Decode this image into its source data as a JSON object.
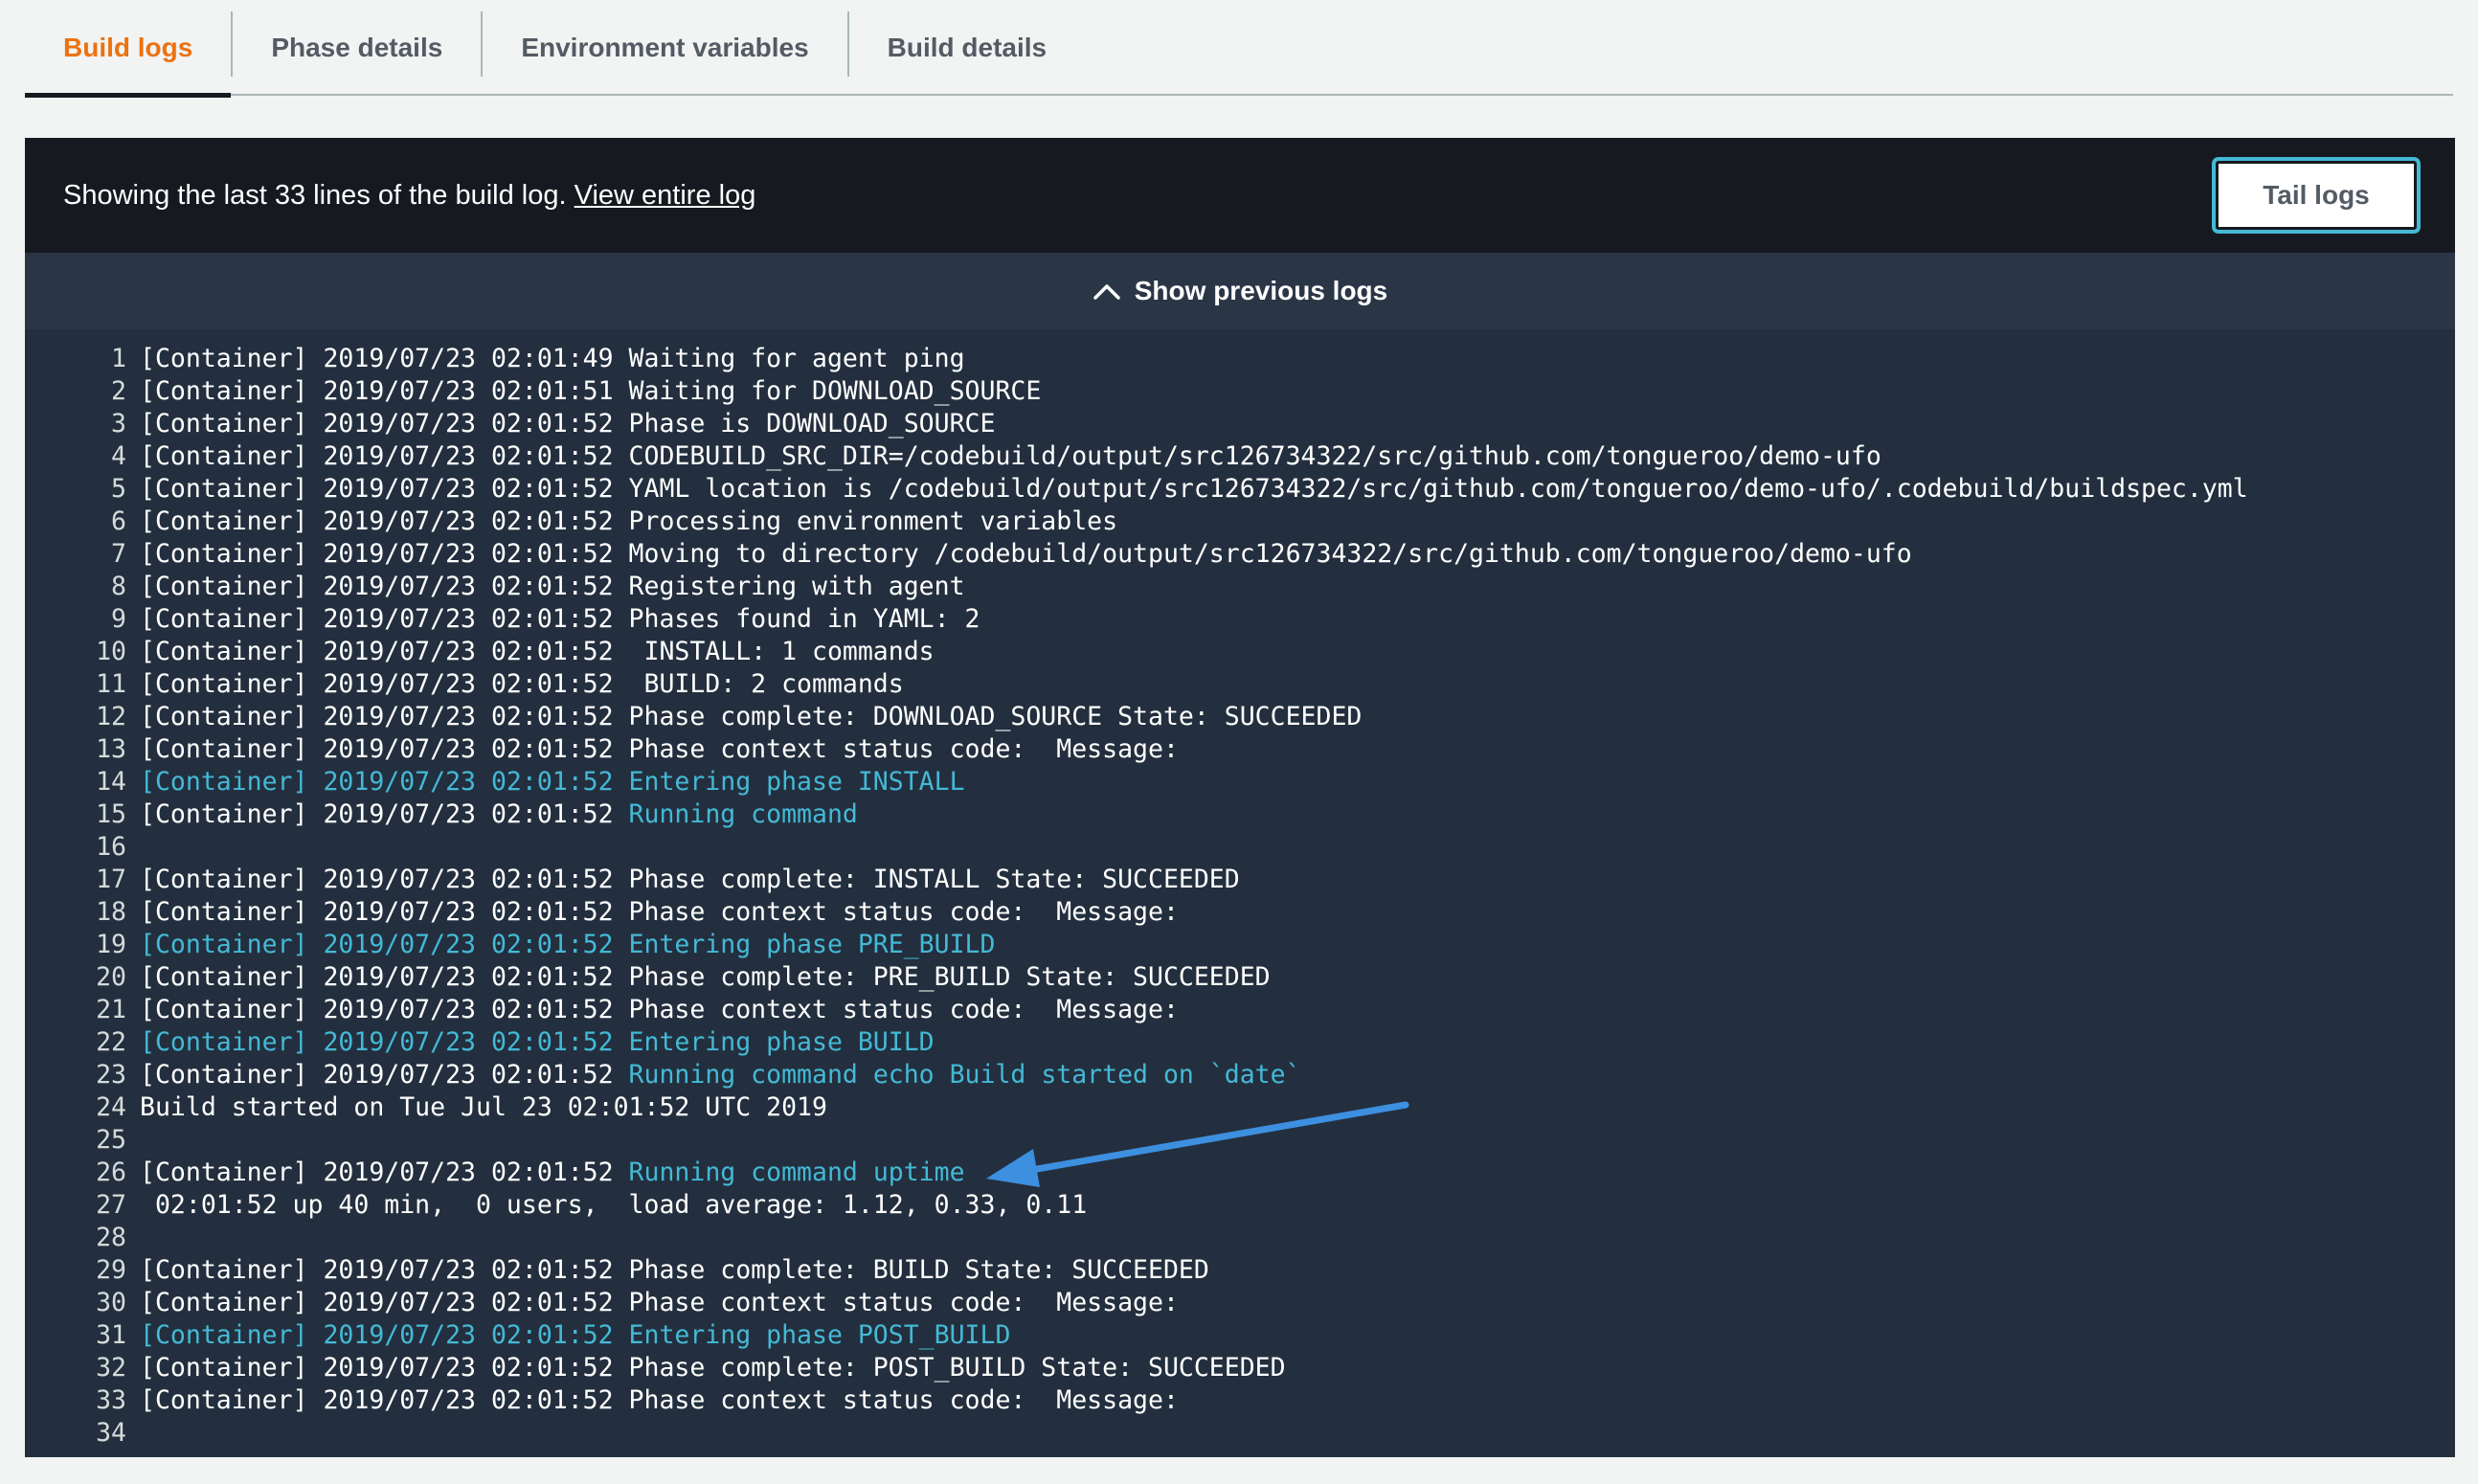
{
  "tabs": [
    {
      "label": "Build logs",
      "active": true
    },
    {
      "label": "Phase details",
      "active": false
    },
    {
      "label": "Environment variables",
      "active": false
    },
    {
      "label": "Build details",
      "active": false
    }
  ],
  "panel": {
    "showing_text": "Showing the last 33 lines of the build log. ",
    "view_entire_log": "View entire log",
    "tail_logs_button": "Tail logs",
    "show_previous_logs": "Show previous logs"
  },
  "colors": {
    "accent_orange": "#ec7211",
    "panel_dark": "#232f3e",
    "header_dark": "#16191f",
    "highlight_blue": "#44b9d6",
    "arrow_blue": "#3d8fe0"
  },
  "log_lines": [
    {
      "num": "1",
      "segments": [
        {
          "t": "[Container] 2019/07/23 02:01:49 Waiting for agent ping"
        }
      ]
    },
    {
      "num": "2",
      "segments": [
        {
          "t": "[Container] 2019/07/23 02:01:51 Waiting for DOWNLOAD_SOURCE"
        }
      ]
    },
    {
      "num": "3",
      "segments": [
        {
          "t": "[Container] 2019/07/23 02:01:52 Phase is DOWNLOAD_SOURCE"
        }
      ]
    },
    {
      "num": "4",
      "segments": [
        {
          "t": "[Container] 2019/07/23 02:01:52 CODEBUILD_SRC_DIR=/codebuild/output/src126734322/src/github.com/tongueroo/demo-ufo"
        }
      ]
    },
    {
      "num": "5",
      "segments": [
        {
          "t": "[Container] 2019/07/23 02:01:52 YAML location is /codebuild/output/src126734322/src/github.com/tongueroo/demo-ufo/.codebuild/buildspec.yml"
        }
      ]
    },
    {
      "num": "6",
      "segments": [
        {
          "t": "[Container] 2019/07/23 02:01:52 Processing environment variables"
        }
      ]
    },
    {
      "num": "7",
      "segments": [
        {
          "t": "[Container] 2019/07/23 02:01:52 Moving to directory /codebuild/output/src126734322/src/github.com/tongueroo/demo-ufo"
        }
      ]
    },
    {
      "num": "8",
      "segments": [
        {
          "t": "[Container] 2019/07/23 02:01:52 Registering with agent"
        }
      ]
    },
    {
      "num": "9",
      "segments": [
        {
          "t": "[Container] 2019/07/23 02:01:52 Phases found in YAML: 2"
        }
      ]
    },
    {
      "num": "10",
      "segments": [
        {
          "t": "[Container] 2019/07/23 02:01:52  INSTALL: 1 commands"
        }
      ]
    },
    {
      "num": "11",
      "segments": [
        {
          "t": "[Container] 2019/07/23 02:01:52  BUILD: 2 commands"
        }
      ]
    },
    {
      "num": "12",
      "segments": [
        {
          "t": "[Container] 2019/07/23 02:01:52 Phase complete: DOWNLOAD_SOURCE State: SUCCEEDED"
        }
      ]
    },
    {
      "num": "13",
      "segments": [
        {
          "t": "[Container] 2019/07/23 02:01:52 Phase context status code:  Message:"
        }
      ]
    },
    {
      "num": "14",
      "segments": [
        {
          "t": "[Container] 2019/07/23 02:01:52 Entering phase INSTALL",
          "hl": true
        }
      ]
    },
    {
      "num": "15",
      "segments": [
        {
          "t": "[Container] 2019/07/23 02:01:52 "
        },
        {
          "t": "Running command",
          "hl": true
        }
      ]
    },
    {
      "num": "16",
      "segments": [
        {
          "t": ""
        }
      ]
    },
    {
      "num": "17",
      "segments": [
        {
          "t": "[Container] 2019/07/23 02:01:52 Phase complete: INSTALL State: SUCCEEDED"
        }
      ]
    },
    {
      "num": "18",
      "segments": [
        {
          "t": "[Container] 2019/07/23 02:01:52 Phase context status code:  Message:"
        }
      ]
    },
    {
      "num": "19",
      "segments": [
        {
          "t": "[Container] 2019/07/23 02:01:52 Entering phase PRE_BUILD",
          "hl": true
        }
      ]
    },
    {
      "num": "20",
      "segments": [
        {
          "t": "[Container] 2019/07/23 02:01:52 Phase complete: PRE_BUILD State: SUCCEEDED"
        }
      ]
    },
    {
      "num": "21",
      "segments": [
        {
          "t": "[Container] 2019/07/23 02:01:52 Phase context status code:  Message:"
        }
      ]
    },
    {
      "num": "22",
      "segments": [
        {
          "t": "[Container] 2019/07/23 02:01:52 Entering phase BUILD",
          "hl": true
        }
      ]
    },
    {
      "num": "23",
      "segments": [
        {
          "t": "[Container] 2019/07/23 02:01:52 "
        },
        {
          "t": "Running command echo Build started on `date`",
          "hl": true
        }
      ]
    },
    {
      "num": "24",
      "segments": [
        {
          "t": "Build started on Tue Jul 23 02:01:52 UTC 2019"
        }
      ]
    },
    {
      "num": "25",
      "segments": [
        {
          "t": ""
        }
      ]
    },
    {
      "num": "26",
      "segments": [
        {
          "t": "[Container] 2019/07/23 02:01:52 "
        },
        {
          "t": "Running command uptime",
          "hl": true
        }
      ]
    },
    {
      "num": "27",
      "segments": [
        {
          "t": " 02:01:52 up 40 min,  0 users,  load average: 1.12, 0.33, 0.11"
        }
      ]
    },
    {
      "num": "28",
      "segments": [
        {
          "t": ""
        }
      ]
    },
    {
      "num": "29",
      "segments": [
        {
          "t": "[Container] 2019/07/23 02:01:52 Phase complete: BUILD State: SUCCEEDED"
        }
      ]
    },
    {
      "num": "30",
      "segments": [
        {
          "t": "[Container] 2019/07/23 02:01:52 Phase context status code:  Message:"
        }
      ]
    },
    {
      "num": "31",
      "segments": [
        {
          "t": "[Container] 2019/07/23 02:01:52 Entering phase POST_BUILD",
          "hl": true
        }
      ]
    },
    {
      "num": "32",
      "segments": [
        {
          "t": "[Container] 2019/07/23 02:01:52 Phase complete: POST_BUILD State: SUCCEEDED"
        }
      ]
    },
    {
      "num": "33",
      "segments": [
        {
          "t": "[Container] 2019/07/23 02:01:52 Phase context status code:  Message:"
        }
      ]
    },
    {
      "num": "34",
      "segments": [
        {
          "t": ""
        }
      ]
    }
  ]
}
